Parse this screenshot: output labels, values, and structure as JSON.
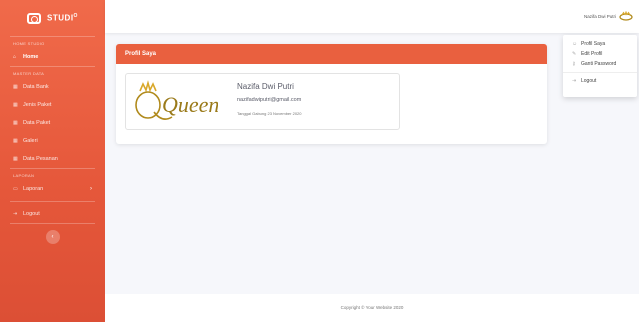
{
  "brand": {
    "name": "STUDI",
    "sup": "O"
  },
  "sidebar": {
    "section_home": "HOME STUDIO",
    "home": "Home",
    "section_master": "MASTER DATA",
    "items": [
      {
        "label": "Data Bank"
      },
      {
        "label": "Jenis Paket"
      },
      {
        "label": "Data Paket"
      },
      {
        "label": "Galeri"
      },
      {
        "label": "Data Pesanan"
      }
    ],
    "section_laporan": "LAPORAN",
    "laporan": "Laporan",
    "logout": "Logout",
    "toggle": "‹"
  },
  "topbar": {
    "user_name": "Nazifa Dwi Putri"
  },
  "dropdown": {
    "items": [
      {
        "label": "Profil Saya",
        "icon": "user-icon"
      },
      {
        "label": "Edit Profil",
        "icon": "user-edit-icon"
      },
      {
        "label": "Ganti Password",
        "icon": "key-icon"
      }
    ],
    "logout": "Logout"
  },
  "card": {
    "title": "Profil Saya",
    "name": "Nazifa Dwi Putri",
    "email": "nazifadwiputri@gmail.com",
    "joined": "Tanggal Gabung 23 November 2020",
    "image_text": "Queen"
  },
  "footer": {
    "text": "Copyright © Your Website 2020"
  },
  "colors": {
    "accent": "#e9603f",
    "sidebar_top": "#f06a4a",
    "sidebar_bottom": "#dc4f35"
  }
}
